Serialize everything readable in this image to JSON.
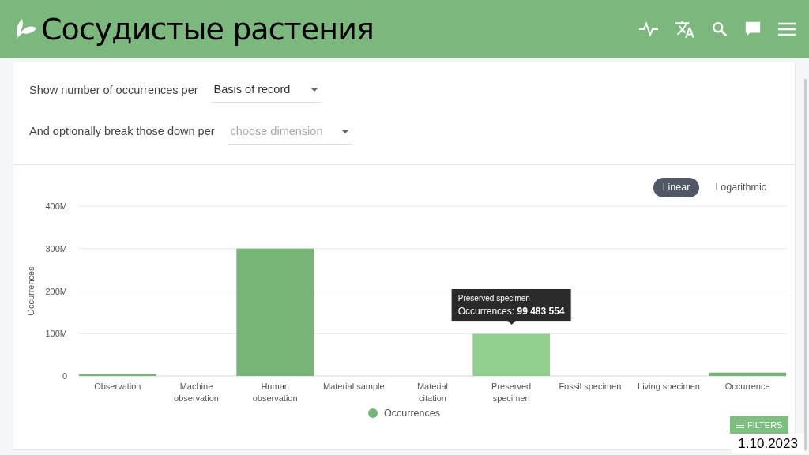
{
  "header": {
    "title": "Сосудистые растения"
  },
  "controls": [
    {
      "label": "Show number of occurrences per",
      "value": "Basis of record"
    },
    {
      "label": "And optionally break those down per",
      "placeholder": "choose dimension"
    }
  ],
  "scale_toggle": [
    {
      "label": "Linear",
      "selected": true
    },
    {
      "label": "Logarithmic",
      "selected": false
    }
  ],
  "chart": {
    "chart_data": {
      "type": "bar",
      "ylabel": "Occurrences",
      "grid": true,
      "categories": [
        "Observation",
        "Machine observation",
        "Human observation",
        "Material sample",
        "Material citation",
        "Preserved specimen",
        "Fossil specimen",
        "Living specimen",
        "Occurrence"
      ],
      "series": [
        {
          "name": "Occurrences",
          "color": "#77b576",
          "values": [
            4000000,
            null,
            300000000,
            null,
            null,
            null,
            null,
            null,
            8000000
          ]
        },
        {
          "color": "#90cf8e",
          "values": [
            null,
            null,
            null,
            null,
            null,
            99500000,
            null,
            null,
            null
          ]
        }
      ],
      "ylim": [
        0,
        400000000
      ],
      "yticks": [
        {
          "value": 0,
          "label": "0"
        },
        {
          "value": 100000000,
          "label": "100M"
        },
        {
          "value": 200000000,
          "label": "200M"
        },
        {
          "value": 300000000,
          "label": "300M"
        },
        {
          "value": 400000000,
          "label": "400M"
        }
      ]
    },
    "tooltip": {
      "title": "Preserved specimen",
      "label": "Occurrences:",
      "value": "99 483 554"
    }
  },
  "filters_button": "FILTERS",
  "date": "1.10.2023"
}
